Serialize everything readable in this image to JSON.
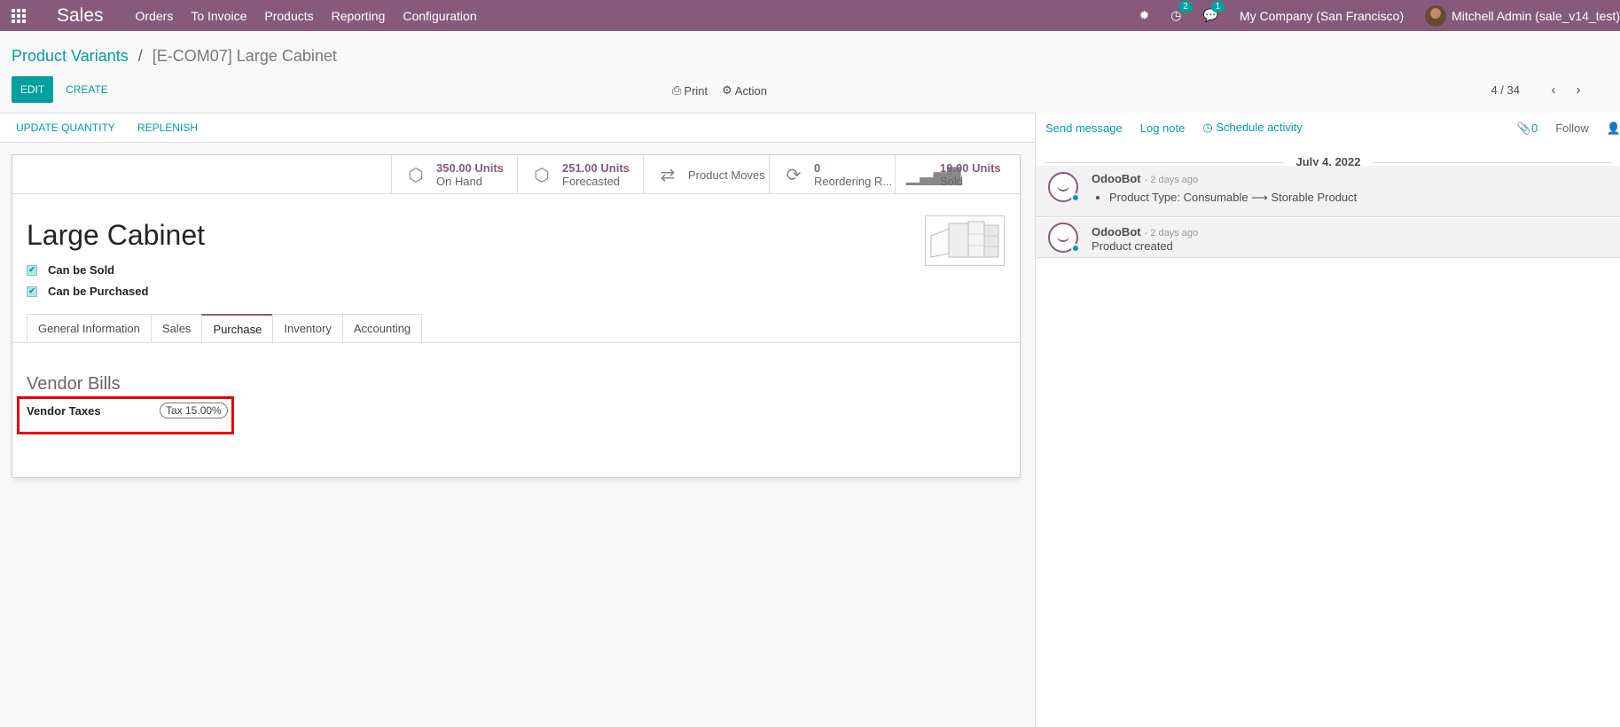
{
  "navbar": {
    "app": "Sales",
    "menu": [
      "Orders",
      "To Invoice",
      "Products",
      "Reporting",
      "Configuration"
    ],
    "activity_count": "2",
    "message_count": "1",
    "company": "My Company (San Francisco)",
    "user": "Mitchell Admin (sale_v14_test)"
  },
  "breadcrumb": {
    "parent": "Product Variants",
    "separator": "/",
    "current": "[E-COM07] Large Cabinet"
  },
  "control": {
    "edit": "EDIT",
    "create": "CREATE",
    "print": "Print",
    "action": "Action",
    "pager": "4 / 34"
  },
  "statusbar": {
    "update_quantity": "UPDATE QUANTITY",
    "replenish": "REPLENISH"
  },
  "smart_buttons": {
    "on_hand_value": "350.00 Units",
    "on_hand_label": "On Hand",
    "forecasted_value": "251.00 Units",
    "forecasted_label": "Forecasted",
    "moves_label": "Product Moves",
    "reordering_value": "0",
    "reordering_label": "Reordering R...",
    "sold_value": "19.00 Units",
    "sold_label": "Sold"
  },
  "product": {
    "name": "Large Cabinet",
    "can_be_sold": "Can be Sold",
    "can_be_purchased": "Can be Purchased"
  },
  "tabs": [
    "General Information",
    "Sales",
    "Purchase",
    "Inventory",
    "Accounting"
  ],
  "active_tab": "Purchase",
  "purchase": {
    "section_title": "Vendor Bills",
    "vendor_taxes_label": "Vendor Taxes",
    "vendor_tax_tag": "Tax 15.00%"
  },
  "chatter": {
    "send_message": "Send message",
    "log_note": "Log note",
    "schedule_activity": "Schedule activity",
    "attachments": "0",
    "follow": "Follow",
    "date": "July 4, 2022",
    "messages": [
      {
        "author": "OdooBot",
        "time": "- 2 days ago",
        "body": "Product Type: Consumable ⟶ Storable Product"
      },
      {
        "author": "OdooBot",
        "time": "- 2 days ago",
        "body": "Product created"
      }
    ]
  },
  "colors": {
    "brand": "#875a7b",
    "accent": "#00a09d",
    "highlight": "#e60000"
  }
}
